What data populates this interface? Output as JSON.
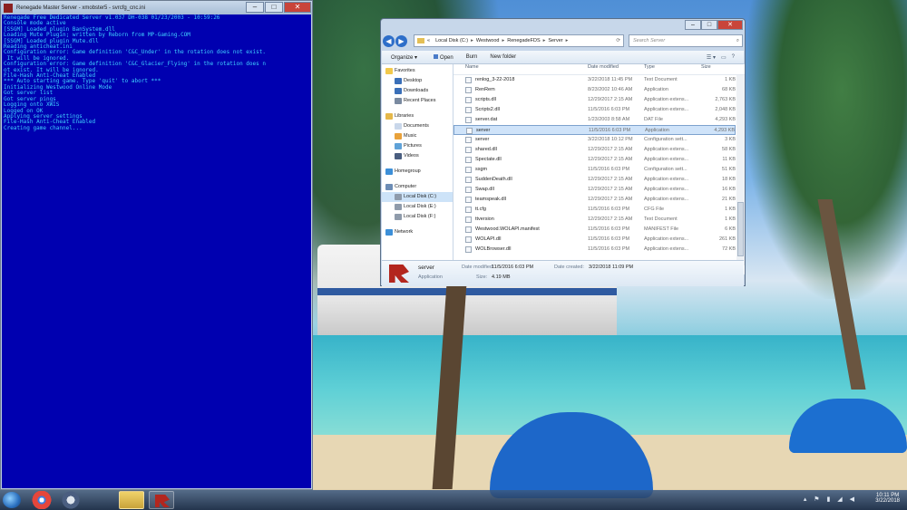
{
  "console": {
    "title": "Renegade Master Server - xmobster5 - svrcfg_cnc.ini",
    "lines": [
      "Renegade Free Dedicated Server v1.037 DH-038 01/23/2003 - 10:59:26",
      "Console mode active",
      "[SSGM] Loaded plugin BanSystem.dll",
      "Loading Mute Plugin; written by Reborn from MP-Gaming.COM",
      "[SSGM] Loaded plugin Mute.dll",
      "Reading anticheat.ini",
      "Configuration error: Game definition 'C&C_Under' in the rotation does not exist.",
      " It will be ignored.",
      "Configuration error: Game definition 'C&C_Glacier_Flying' in the rotation does n",
      "ot exist. It will be ignored.",
      "File-Hash Anti-Cheat Enabled",
      "*** Auto starting game. Type 'quit' to abort ***",
      "Initializing Westwood Online Mode",
      "Got server list",
      "Got server pings",
      "Logging onto XWIS",
      "Logged on OK",
      "Applying server settings",
      "File-Hash Anti-Cheat Enabled",
      "Creating game channel..."
    ]
  },
  "explorer": {
    "address": [
      "Local Disk (C:)",
      "Westwood",
      "RenegadeFDS",
      "Server"
    ],
    "search_placeholder": "Search Server",
    "toolbar": {
      "organize": "Organize ▾",
      "open": "Open",
      "burn": "Burn",
      "new_folder": "New folder"
    },
    "nav": [
      {
        "label": "Favorites",
        "color": "#f2c94c",
        "header": true
      },
      {
        "label": "Desktop",
        "color": "#3a6fb8"
      },
      {
        "label": "Downloads",
        "color": "#3a6fb8"
      },
      {
        "label": "Recent Places",
        "color": "#7a8aa0"
      },
      {
        "label": "Libraries",
        "color": "#e5b84a",
        "header": true
      },
      {
        "label": "Documents",
        "color": "#c9d7ea"
      },
      {
        "label": "Music",
        "color": "#e9a23b"
      },
      {
        "label": "Pictures",
        "color": "#5fa2d8"
      },
      {
        "label": "Videos",
        "color": "#4a5e80"
      },
      {
        "label": "Homegroup",
        "color": "#3c8fd8",
        "header": true
      },
      {
        "label": "Computer",
        "color": "#6d8db5",
        "header": true
      },
      {
        "label": "Local Disk (C:)",
        "color": "#8f9bab",
        "selected": true
      },
      {
        "label": "Local Disk (E:)",
        "color": "#8f9bab"
      },
      {
        "label": "Local Disk (F:)",
        "color": "#8f9bab"
      },
      {
        "label": "Network",
        "color": "#3c8fd8",
        "header": true
      }
    ],
    "columns": {
      "name": "Name",
      "date": "Date modified",
      "type": "Type",
      "size": "Size"
    },
    "files": [
      {
        "name": "renlog_3-22-2018",
        "date": "3/22/2018 11:45 PM",
        "type": "Text Document",
        "size": "1 KB"
      },
      {
        "name": "RenRem",
        "date": "8/23/2002 10:46 AM",
        "type": "Application",
        "size": "68 KB"
      },
      {
        "name": "scripts.dll",
        "date": "12/29/2017 2:15 AM",
        "type": "Application extens...",
        "size": "2,763 KB"
      },
      {
        "name": "Scripts2.dll",
        "date": "11/5/2016 6:03 PM",
        "type": "Application extens...",
        "size": "2,048 KB"
      },
      {
        "name": "server.dat",
        "date": "1/23/2003 8:58 AM",
        "type": "DAT File",
        "size": "4,293 KB"
      },
      {
        "name": "server",
        "date": "11/5/2016 6:03 PM",
        "type": "Application",
        "size": "4,293 KB",
        "selected": true
      },
      {
        "name": "server",
        "date": "3/22/2018 10:12 PM",
        "type": "Configuration sett...",
        "size": "3 KB"
      },
      {
        "name": "shared.dll",
        "date": "12/29/2017 2:15 AM",
        "type": "Application extens...",
        "size": "58 KB"
      },
      {
        "name": "Spectate.dll",
        "date": "12/29/2017 2:15 AM",
        "type": "Application extens...",
        "size": "11 KB"
      },
      {
        "name": "ssgm",
        "date": "11/5/2016 6:03 PM",
        "type": "Configuration sett...",
        "size": "51 KB"
      },
      {
        "name": "SuddenDeath.dll",
        "date": "12/29/2017 2:15 AM",
        "type": "Application extens...",
        "size": "18 KB"
      },
      {
        "name": "Swap.dll",
        "date": "12/29/2017 2:15 AM",
        "type": "Application extens...",
        "size": "16 KB"
      },
      {
        "name": "teamspeak.dll",
        "date": "12/29/2017 2:15 AM",
        "type": "Application extens...",
        "size": "21 KB"
      },
      {
        "name": "tt.cfg",
        "date": "11/5/2016 6:03 PM",
        "type": "CFG File",
        "size": "1 KB"
      },
      {
        "name": "ttversion",
        "date": "12/29/2017 2:15 AM",
        "type": "Text Document",
        "size": "1 KB"
      },
      {
        "name": "Westwood.WOLAPI.manifest",
        "date": "11/5/2016 6:03 PM",
        "type": "MANIFEST File",
        "size": "6 KB"
      },
      {
        "name": "WOLAPI.dll",
        "date": "11/5/2016 6:03 PM",
        "type": "Application extens...",
        "size": "261 KB"
      },
      {
        "name": "WOLBrowser.dll",
        "date": "11/5/2016 6:03 PM",
        "type": "Application extens...",
        "size": "72 KB"
      }
    ],
    "details": {
      "name": "server",
      "kind": "Application",
      "modified_label": "Date modified:",
      "modified": "11/5/2016 6:03 PM",
      "created_label": "Date created:",
      "created": "3/22/2018 11:09 PM",
      "size_label": "Size:",
      "size": "4.19 MB"
    }
  },
  "taskbar": {
    "time": "10:11 PM",
    "date": "3/22/2018"
  }
}
